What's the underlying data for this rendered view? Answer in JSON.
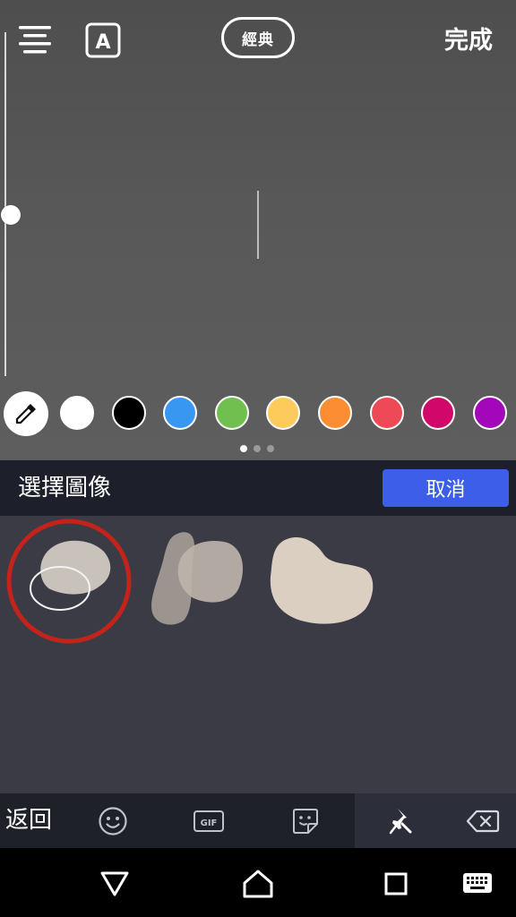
{
  "toolbar": {
    "style_label": "經典",
    "done_label": "完成",
    "font_icon_letter": "A"
  },
  "brush_size_level": 0.47,
  "palette": {
    "colors": [
      "#ffffff",
      "#000000",
      "#3897f0",
      "#70c050",
      "#fdcb5c",
      "#fd8d32",
      "#ed4956",
      "#d10869",
      "#a307ba"
    ],
    "page_count": 3,
    "active_page": 1
  },
  "sticker_picker": {
    "title": "選擇圖像",
    "cancel_label": "取消",
    "cancel_color": "#3d5ee8"
  },
  "keyboard_bar": {
    "back_label": "返回",
    "gif_label": "GIF",
    "icons": [
      "emoji-icon",
      "gif-icon",
      "sticker-icon",
      "pin-icon",
      "backspace-icon"
    ]
  },
  "nav_bar": {
    "icons": [
      "back-triangle-icon",
      "home-icon",
      "recents-icon",
      "keyboard-icon"
    ]
  }
}
